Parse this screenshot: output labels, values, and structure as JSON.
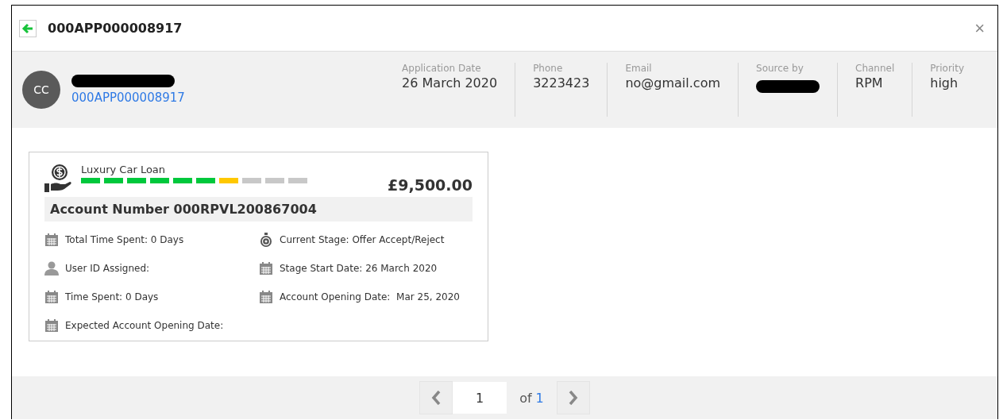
{
  "window": {
    "title": "000APP000008917",
    "close_glyph": "×"
  },
  "applicant": {
    "initials": "CC",
    "name_redacted": true,
    "application_id": "000APP000008917"
  },
  "fields": [
    {
      "label": "Application Date",
      "value": "26 March 2020"
    },
    {
      "label": "Phone",
      "value": "3223423"
    },
    {
      "label": "Email",
      "value": "no@gmail.com"
    },
    {
      "label": "Source by",
      "redacted": true
    },
    {
      "label": "Channel",
      "value": "RPM"
    },
    {
      "label": "Priority",
      "value": "high"
    }
  ],
  "card": {
    "product": "Luxury Car Loan",
    "amount": "£9,500.00",
    "stages": [
      {
        "color": "#00c83c"
      },
      {
        "color": "#00c83c"
      },
      {
        "color": "#00c83c"
      },
      {
        "color": "#00c83c"
      },
      {
        "color": "#00c83c"
      },
      {
        "color": "#00c83c"
      },
      {
        "color": "#ffc800"
      },
      {
        "color": "#c8c8c8"
      },
      {
        "color": "#c8c8c8"
      },
      {
        "color": "#c8c8c8"
      }
    ],
    "account_number": "Account Number 000RPVL200867004",
    "details": [
      {
        "kind": "calendar",
        "text": "Total Time Spent: 0 Days"
      },
      {
        "kind": "stopwatch",
        "text": "Current Stage: Offer Accept/Reject"
      },
      {
        "kind": "user",
        "text": "User ID Assigned:"
      },
      {
        "kind": "calendar",
        "text": "Stage Start Date: 26 March 2020"
      },
      {
        "kind": "calendar",
        "text": "Time Spent: 0 Days"
      },
      {
        "kind": "calendar",
        "text": "Account Opening Date:  Mar 25, 2020"
      },
      {
        "kind": "calendar",
        "text": "Expected Account Opening Date:"
      }
    ]
  },
  "pager": {
    "page": "1",
    "of_label": "of",
    "total": "1"
  }
}
